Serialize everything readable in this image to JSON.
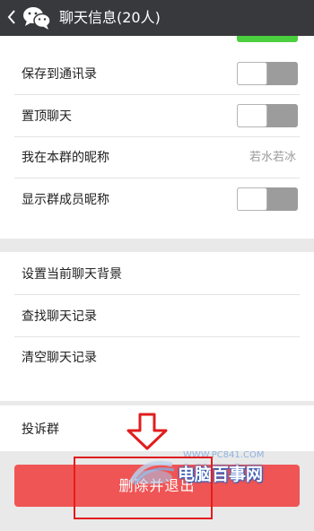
{
  "header": {
    "title": "聊天信息(20人)",
    "back_icon": "chevron-left-icon",
    "logo_icon": "wechat-icon"
  },
  "settings": {
    "save_to_contacts": {
      "label": "保存到通讯录",
      "toggle_on": false
    },
    "sticky_on_top": {
      "label": "置顶聊天",
      "toggle_on": false
    },
    "my_group_nickname": {
      "label": "我在本群的昵称",
      "value": "若水若冰"
    },
    "show_member_nicknames": {
      "label": "显示群成员昵称",
      "toggle_on": false
    }
  },
  "chat_actions": {
    "set_background": "设置当前聊天背景",
    "search_history": "查找聊天记录",
    "clear_history": "清空聊天记录"
  },
  "report": {
    "label": "投诉群"
  },
  "delete_button": {
    "label": "删除并退出"
  },
  "watermark": {
    "url": "WWW.PC841.COM",
    "title": "电脑百事网"
  },
  "colors": {
    "titlebar": "#38393d",
    "background": "#e9e9e9",
    "toggle_off": "#9c9c9c",
    "toggle_on": "#4ccf3e",
    "danger": "#f05555",
    "annotation": "#e11d1d"
  }
}
